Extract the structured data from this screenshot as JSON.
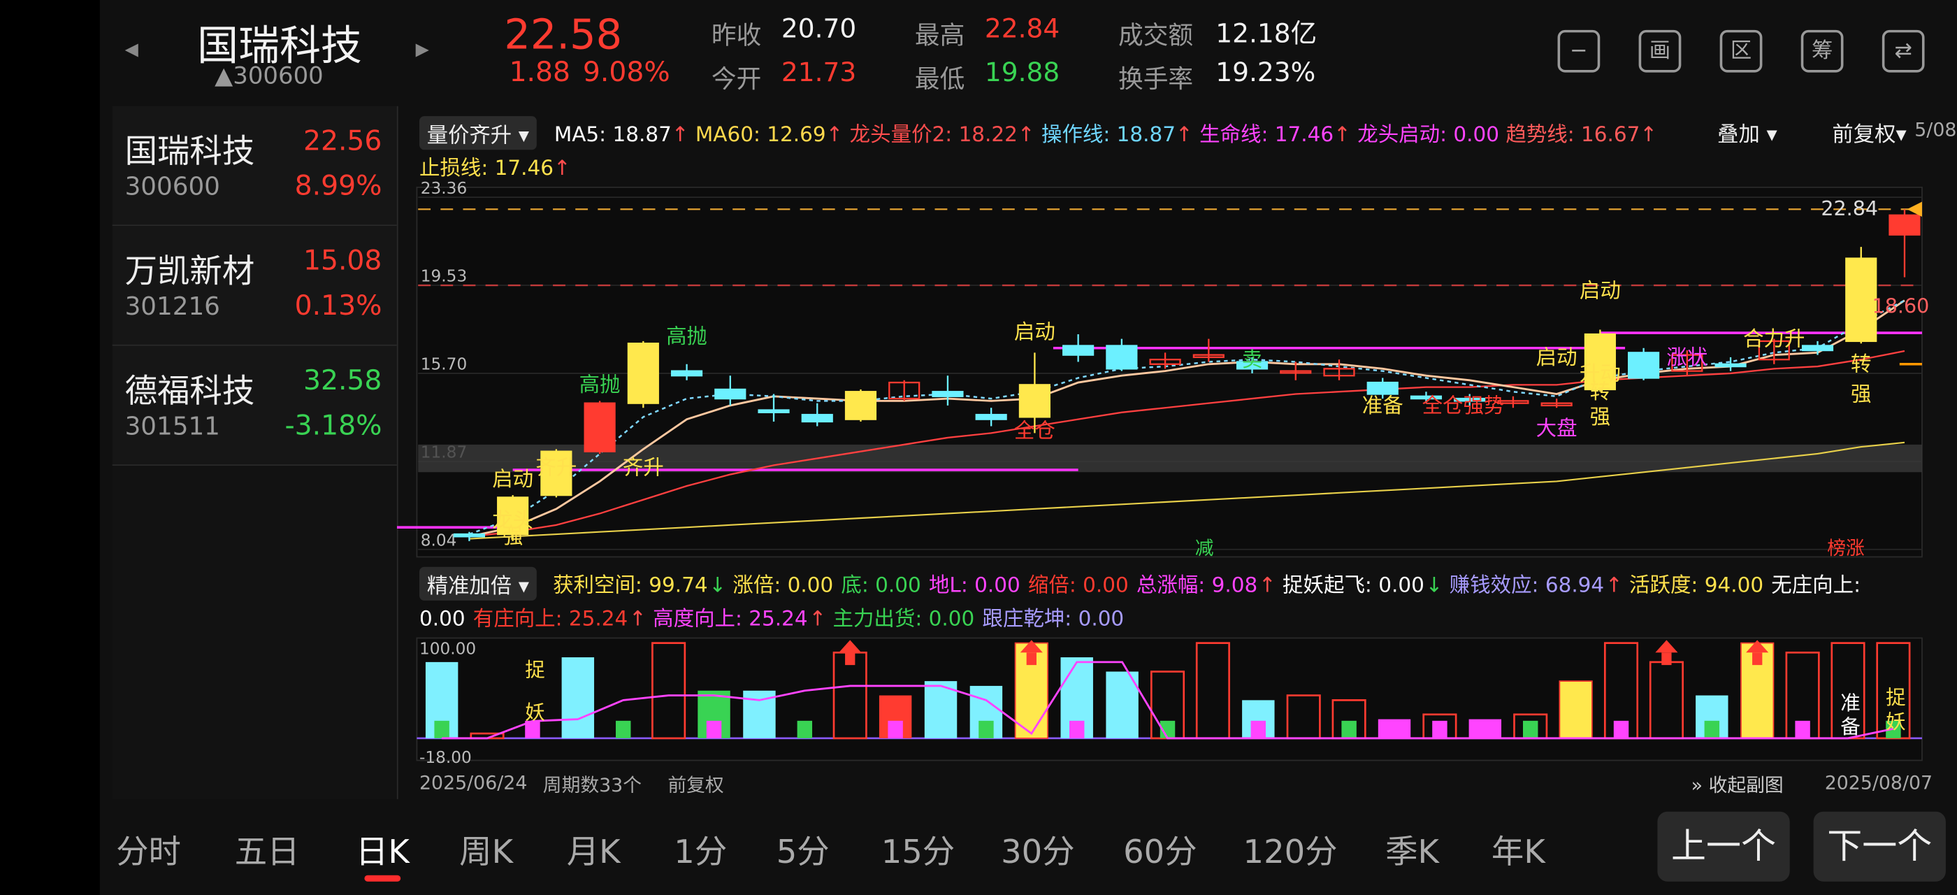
{
  "stock": {
    "name": "国瑞科技",
    "code": "300600",
    "price": "22.58",
    "change": "1.88",
    "change_pct": "9.08%",
    "stats": [
      {
        "label": "昨收",
        "value": "20.70",
        "color": "#f2f2f2"
      },
      {
        "label": "今开",
        "value": "21.73",
        "color": "#ff3b30"
      },
      {
        "label": "最高",
        "value": "22.84",
        "color": "#ff3b30"
      },
      {
        "label": "最低",
        "value": "19.88",
        "color": "#39d353"
      },
      {
        "label": "成交额",
        "value": "12.18亿",
        "color": "#f2f2f2"
      },
      {
        "label": "换手率",
        "value": "19.23%",
        "color": "#f2f2f2"
      }
    ]
  },
  "toolbar_icons": [
    "minus-icon",
    "picture-icon",
    "district-icon",
    "chip-icon",
    "phone-rotate-icon"
  ],
  "toolbar_glyphs": [
    "−",
    "画",
    "区",
    "筹",
    "⇄"
  ],
  "watchlist": [
    {
      "name": "国瑞科技",
      "code": "300600",
      "price": "22.56",
      "pct": "8.99%",
      "color": "#ff3b30"
    },
    {
      "name": "万凯新材",
      "code": "301216",
      "price": "15.08",
      "pct": "0.13%",
      "color": "#ff3b30"
    },
    {
      "name": "德福科技",
      "code": "301511",
      "price": "32.58",
      "pct": "-3.18%",
      "color": "#39d353"
    }
  ],
  "main_chart": {
    "indicator_select": "量价齐升",
    "overlay_select": "叠加",
    "adjust_select": "前复权",
    "date_stub": "5/08",
    "indicators": [
      {
        "label": "MA5: 18.87",
        "arrow": "↑",
        "color": "#ffffff"
      },
      {
        "label": "MA60: 12.69",
        "arrow": "↑",
        "color": "#ffd84d"
      },
      {
        "label": "龙头量价2: 18.22",
        "arrow": "↑",
        "color": "#ff4d4d"
      },
      {
        "label": "操作线: 18.87",
        "arrow": "↑",
        "color": "#6fd6ff"
      },
      {
        "label": "生命线: 17.46",
        "arrow": "↑",
        "color": "#ff44ff"
      },
      {
        "label": "龙头启动: 0.00",
        "arrow": "",
        "color": "#ff44ff"
      },
      {
        "label": "趋势线: 16.67",
        "arrow": "↑",
        "color": "#ff5a5a"
      }
    ],
    "stoploss": {
      "label": "止损线: 17.46",
      "arrow": "↑",
      "color": "#ffe14d"
    },
    "y_ticks": [
      "23.36",
      "19.53",
      "15.70",
      "11.87",
      "8.04"
    ],
    "ylim": [
      8.04,
      23.36
    ],
    "high_label": "22.84",
    "low_label": "18.60",
    "candles": [
      {
        "o": 8.7,
        "c": 8.6,
        "h": 8.8,
        "l": 8.4
      },
      {
        "o": 8.7,
        "c": 10.3,
        "h": 10.4,
        "l": 8.4
      },
      {
        "o": 10.4,
        "c": 12.3,
        "h": 12.4,
        "l": 10.3
      },
      {
        "o": 12.3,
        "c": 14.4,
        "h": 14.5,
        "l": 12.2
      },
      {
        "o": 14.4,
        "c": 17.0,
        "h": 17.1,
        "l": 14.2
      },
      {
        "o": 15.8,
        "c": 15.6,
        "h": 16.1,
        "l": 15.4
      },
      {
        "o": 15.0,
        "c": 14.6,
        "h": 15.6,
        "l": 14.3
      },
      {
        "o": 14.1,
        "c": 14.0,
        "h": 14.8,
        "l": 13.6
      },
      {
        "o": 13.9,
        "c": 13.6,
        "h": 14.4,
        "l": 13.4
      },
      {
        "o": 13.7,
        "c": 14.9,
        "h": 15.0,
        "l": 13.6
      },
      {
        "o": 14.6,
        "c": 15.3,
        "h": 15.4,
        "l": 14.5
      },
      {
        "o": 14.9,
        "c": 14.7,
        "h": 15.6,
        "l": 14.3
      },
      {
        "o": 13.9,
        "c": 13.7,
        "h": 14.2,
        "l": 13.4
      },
      {
        "o": 13.8,
        "c": 15.2,
        "h": 16.6,
        "l": 13.1
      },
      {
        "o": 16.9,
        "c": 16.5,
        "h": 17.4,
        "l": 16.2
      },
      {
        "o": 16.9,
        "c": 15.9,
        "h": 17.2,
        "l": 15.8
      },
      {
        "o": 16.1,
        "c": 16.3,
        "h": 16.6,
        "l": 15.9
      },
      {
        "o": 16.4,
        "c": 16.5,
        "h": 17.2,
        "l": 16.2
      },
      {
        "o": 16.2,
        "c": 15.9,
        "h": 16.4,
        "l": 15.7
      },
      {
        "o": 15.8,
        "c": 15.8,
        "h": 16.2,
        "l": 15.4
      },
      {
        "o": 15.6,
        "c": 15.9,
        "h": 16.3,
        "l": 15.4
      },
      {
        "o": 15.3,
        "c": 14.8,
        "h": 15.5,
        "l": 14.6
      },
      {
        "o": 14.7,
        "c": 14.6,
        "h": 14.9,
        "l": 14.4
      },
      {
        "o": 14.6,
        "c": 14.5,
        "h": 14.8,
        "l": 14.3
      },
      {
        "o": 14.4,
        "c": 14.5,
        "h": 14.7,
        "l": 14.2
      },
      {
        "o": 14.3,
        "c": 14.4,
        "h": 14.6,
        "l": 14.2
      },
      {
        "o": 15.0,
        "c": 17.4,
        "h": 17.6,
        "l": 14.9
      },
      {
        "o": 16.6,
        "c": 15.5,
        "h": 16.8,
        "l": 15.4
      },
      {
        "o": 15.8,
        "c": 16.5,
        "h": 16.7,
        "l": 15.6
      },
      {
        "o": 16.1,
        "c": 16.0,
        "h": 16.4,
        "l": 15.8
      },
      {
        "o": 16.3,
        "c": 17.1,
        "h": 17.2,
        "l": 16.1
      },
      {
        "o": 16.9,
        "c": 16.7,
        "h": 17.1,
        "l": 16.5
      },
      {
        "o": 17.1,
        "c": 20.7,
        "h": 21.2,
        "l": 17.0
      },
      {
        "o": 21.73,
        "c": 22.58,
        "h": 22.84,
        "l": 19.88
      }
    ],
    "lines": {
      "ma60": [
        8.5,
        8.6,
        8.7,
        8.8,
        8.9,
        9.0,
        9.1,
        9.2,
        9.3,
        9.4,
        9.5,
        9.6,
        9.7,
        9.8,
        9.9,
        10.0,
        10.1,
        10.2,
        10.3,
        10.4,
        10.5,
        10.6,
        10.7,
        10.8,
        10.9,
        11.0,
        11.2,
        11.4,
        11.6,
        11.8,
        12.0,
        12.2,
        12.5,
        12.69
      ],
      "trend": [
        8.6,
        8.8,
        9.1,
        9.6,
        10.2,
        10.8,
        11.3,
        11.7,
        12.0,
        12.3,
        12.6,
        12.9,
        13.1,
        13.4,
        13.7,
        14.0,
        14.2,
        14.4,
        14.6,
        14.8,
        14.9,
        15.0,
        15.1,
        15.1,
        15.2,
        15.2,
        15.4,
        15.5,
        15.6,
        15.7,
        15.9,
        16.0,
        16.3,
        16.67
      ],
      "ma5": [
        8.6,
        9.0,
        9.8,
        11.0,
        12.4,
        13.7,
        14.3,
        14.7,
        14.6,
        14.5,
        14.5,
        14.6,
        14.5,
        14.6,
        15.3,
        15.6,
        15.8,
        16.1,
        16.2,
        16.1,
        16.1,
        15.9,
        15.6,
        15.4,
        15.1,
        14.8,
        15.4,
        15.7,
        15.9,
        16.0,
        16.5,
        16.6,
        17.6,
        18.87
      ],
      "operate": [
        8.7,
        9.4,
        10.6,
        12.2,
        13.8,
        14.6,
        14.8,
        14.7,
        14.5,
        14.5,
        14.7,
        14.8,
        14.6,
        14.9,
        15.5,
        15.9,
        16.0,
        16.2,
        16.3,
        16.2,
        16.0,
        15.8,
        15.5,
        15.2,
        14.9,
        14.7,
        15.5,
        15.8,
        16.0,
        16.2,
        16.6,
        16.8,
        17.9,
        18.87
      ]
    },
    "hlines": {
      "dash_top": 22.84,
      "dash_mid": 19.53,
      "magenta": 17.46,
      "orange_tick": 16.1,
      "magenta_low": 11.5
    },
    "signals": [
      {
        "text": "启动",
        "color": "#ffe14d"
      },
      {
        "text": "龙头",
        "color": "#ffe14d"
      },
      {
        "text": "强",
        "color": "#ffe14d"
      },
      {
        "text": "齐升",
        "color": "#ffe14d"
      },
      {
        "text": "高抛",
        "color": "#39d353"
      },
      {
        "text": "齐升",
        "color": "#ffe14d"
      },
      {
        "text": "高抛",
        "color": "#39d353"
      },
      {
        "text": "启动",
        "color": "#ffe14d"
      },
      {
        "text": "全仓",
        "color": "#ff3b30"
      },
      {
        "text": "卖",
        "color": "#39d353"
      },
      {
        "text": "准备",
        "color": "#ffe14d"
      },
      {
        "text": "全仓强势",
        "color": "#ff3b30"
      },
      {
        "text": "大盘",
        "color": "#ff44ff"
      },
      {
        "text": "启动",
        "color": "#ffe14d"
      },
      {
        "text": "升动",
        "color": "#ffe14d"
      },
      {
        "text": "启动",
        "color": "#ffe14d"
      },
      {
        "text": "转",
        "color": "#ffe14d"
      },
      {
        "text": "强",
        "color": "#ffe14d"
      },
      {
        "text": "涨状",
        "color": "#ff44ff"
      },
      {
        "text": "合力升",
        "color": "#ffe14d"
      },
      {
        "text": "转",
        "color": "#ffe14d"
      },
      {
        "text": "强",
        "color": "#ffe14d"
      }
    ],
    "bottom_tags": [
      {
        "text": "减",
        "color": "#39d353"
      },
      {
        "text": "榜涨",
        "color": "#ff3b30"
      }
    ]
  },
  "sub_chart": {
    "indicator_select": "精准加倍",
    "indicators": [
      {
        "label": "获利空间: 99.74",
        "arrow": "↓",
        "color": "#ffe14d"
      },
      {
        "label": "涨倍: 0.00",
        "arrow": "",
        "color": "#ffe14d"
      },
      {
        "label": "底: 0.00",
        "arrow": "",
        "color": "#39d353"
      },
      {
        "label": "地L: 0.00",
        "arrow": "",
        "color": "#ff44ff"
      },
      {
        "label": "缩倍: 0.00",
        "arrow": "",
        "color": "#ff3b30"
      },
      {
        "label": "总涨幅: 9.08",
        "arrow": "↑",
        "color": "#ff44ff"
      },
      {
        "label": "捉妖起飞: 0.00",
        "arrow": "↓",
        "color": "#ffffff"
      },
      {
        "label": "赚钱效应: 68.94",
        "arrow": "↑",
        "color": "#a89cff"
      },
      {
        "label": "活跃度: 94.00",
        "arrow": "",
        "color": "#ffe14d"
      },
      {
        "label": "无庄向上:",
        "arrow": "",
        "color": "#ffffff"
      }
    ],
    "indicators_row2": [
      {
        "label": "0.00",
        "arrow": "",
        "color": "#ffffff"
      },
      {
        "label": "有庄向上: 25.24",
        "arrow": "↑",
        "color": "#ff3b30"
      },
      {
        "label": "高度向上: 25.24",
        "arrow": "↑",
        "color": "#ff44ff"
      },
      {
        "label": "主力出货: 0.00",
        "arrow": "",
        "color": "#39d353"
      },
      {
        "label": "跟庄乾坤: 0.00",
        "arrow": "",
        "color": "#a89cff"
      }
    ],
    "y_max": "100.00",
    "y_min": "-18.00",
    "ylim": [
      -18,
      100
    ],
    "bars": [
      {
        "v": 80,
        "k": "cyan"
      },
      {
        "v": 5,
        "k": "redo"
      },
      {
        "v": 20,
        "k": "none"
      },
      {
        "v": 85,
        "k": "cyan"
      },
      {
        "v": 20,
        "k": "none"
      },
      {
        "v": 100,
        "k": "redo"
      },
      {
        "v": 50,
        "k": "green"
      },
      {
        "v": 50,
        "k": "cyan"
      },
      {
        "v": 40,
        "k": "none"
      },
      {
        "v": 90,
        "k": "redo"
      },
      {
        "v": 45,
        "k": "mix"
      },
      {
        "v": 60,
        "k": "cyan"
      },
      {
        "v": 55,
        "k": "cyan"
      },
      {
        "v": 100,
        "k": "yellow"
      },
      {
        "v": 85,
        "k": "cyan"
      },
      {
        "v": 70,
        "k": "cyan"
      },
      {
        "v": 70,
        "k": "redo"
      },
      {
        "v": 100,
        "k": "redo"
      },
      {
        "v": 40,
        "k": "cyan"
      },
      {
        "v": 45,
        "k": "redo"
      },
      {
        "v": 40,
        "k": "redo"
      },
      {
        "v": 20,
        "k": "mag"
      },
      {
        "v": 25,
        "k": "redo"
      },
      {
        "v": 20,
        "k": "mag"
      },
      {
        "v": 25,
        "k": "redo"
      },
      {
        "v": 60,
        "k": "yellow"
      },
      {
        "v": 100,
        "k": "redo"
      },
      {
        "v": 80,
        "k": "redo"
      },
      {
        "v": 45,
        "k": "cyan"
      },
      {
        "v": 100,
        "k": "yellow"
      },
      {
        "v": 90,
        "k": "redo"
      },
      {
        "v": 100,
        "k": "redo"
      },
      {
        "v": 100,
        "k": "redo"
      }
    ],
    "magenta_line": [
      0,
      0,
      18,
      20,
      40,
      45,
      45,
      40,
      50,
      55,
      55,
      55,
      40,
      5,
      80,
      80,
      0,
      0,
      0,
      0,
      0,
      0,
      0,
      0,
      0,
      0,
      0,
      0,
      0,
      0,
      0,
      0,
      10
    ],
    "labels": [
      {
        "text": "捉",
        "color": "#ffe14d"
      },
      {
        "text": "妖",
        "color": "#ffe14d"
      },
      {
        "text": "准",
        "color": "#ffffff"
      },
      {
        "text": "备",
        "color": "#ffffff"
      },
      {
        "text": "捉",
        "color": "#ffe14d"
      },
      {
        "text": "妖",
        "color": "#ffe14d"
      }
    ],
    "start_date": "2025/06/24",
    "period_count": "周期数33个",
    "adjust": "前复权",
    "collapse": "收起副图",
    "end_date": "2025/08/07"
  },
  "period_tabs": [
    "分时",
    "五日",
    "日K",
    "周K",
    "月K",
    "1分",
    "5分",
    "15分",
    "30分",
    "60分",
    "120分",
    "季K",
    "年K"
  ],
  "active_tab": "日K",
  "prev_button": "上一个",
  "next_button": "下一个"
}
